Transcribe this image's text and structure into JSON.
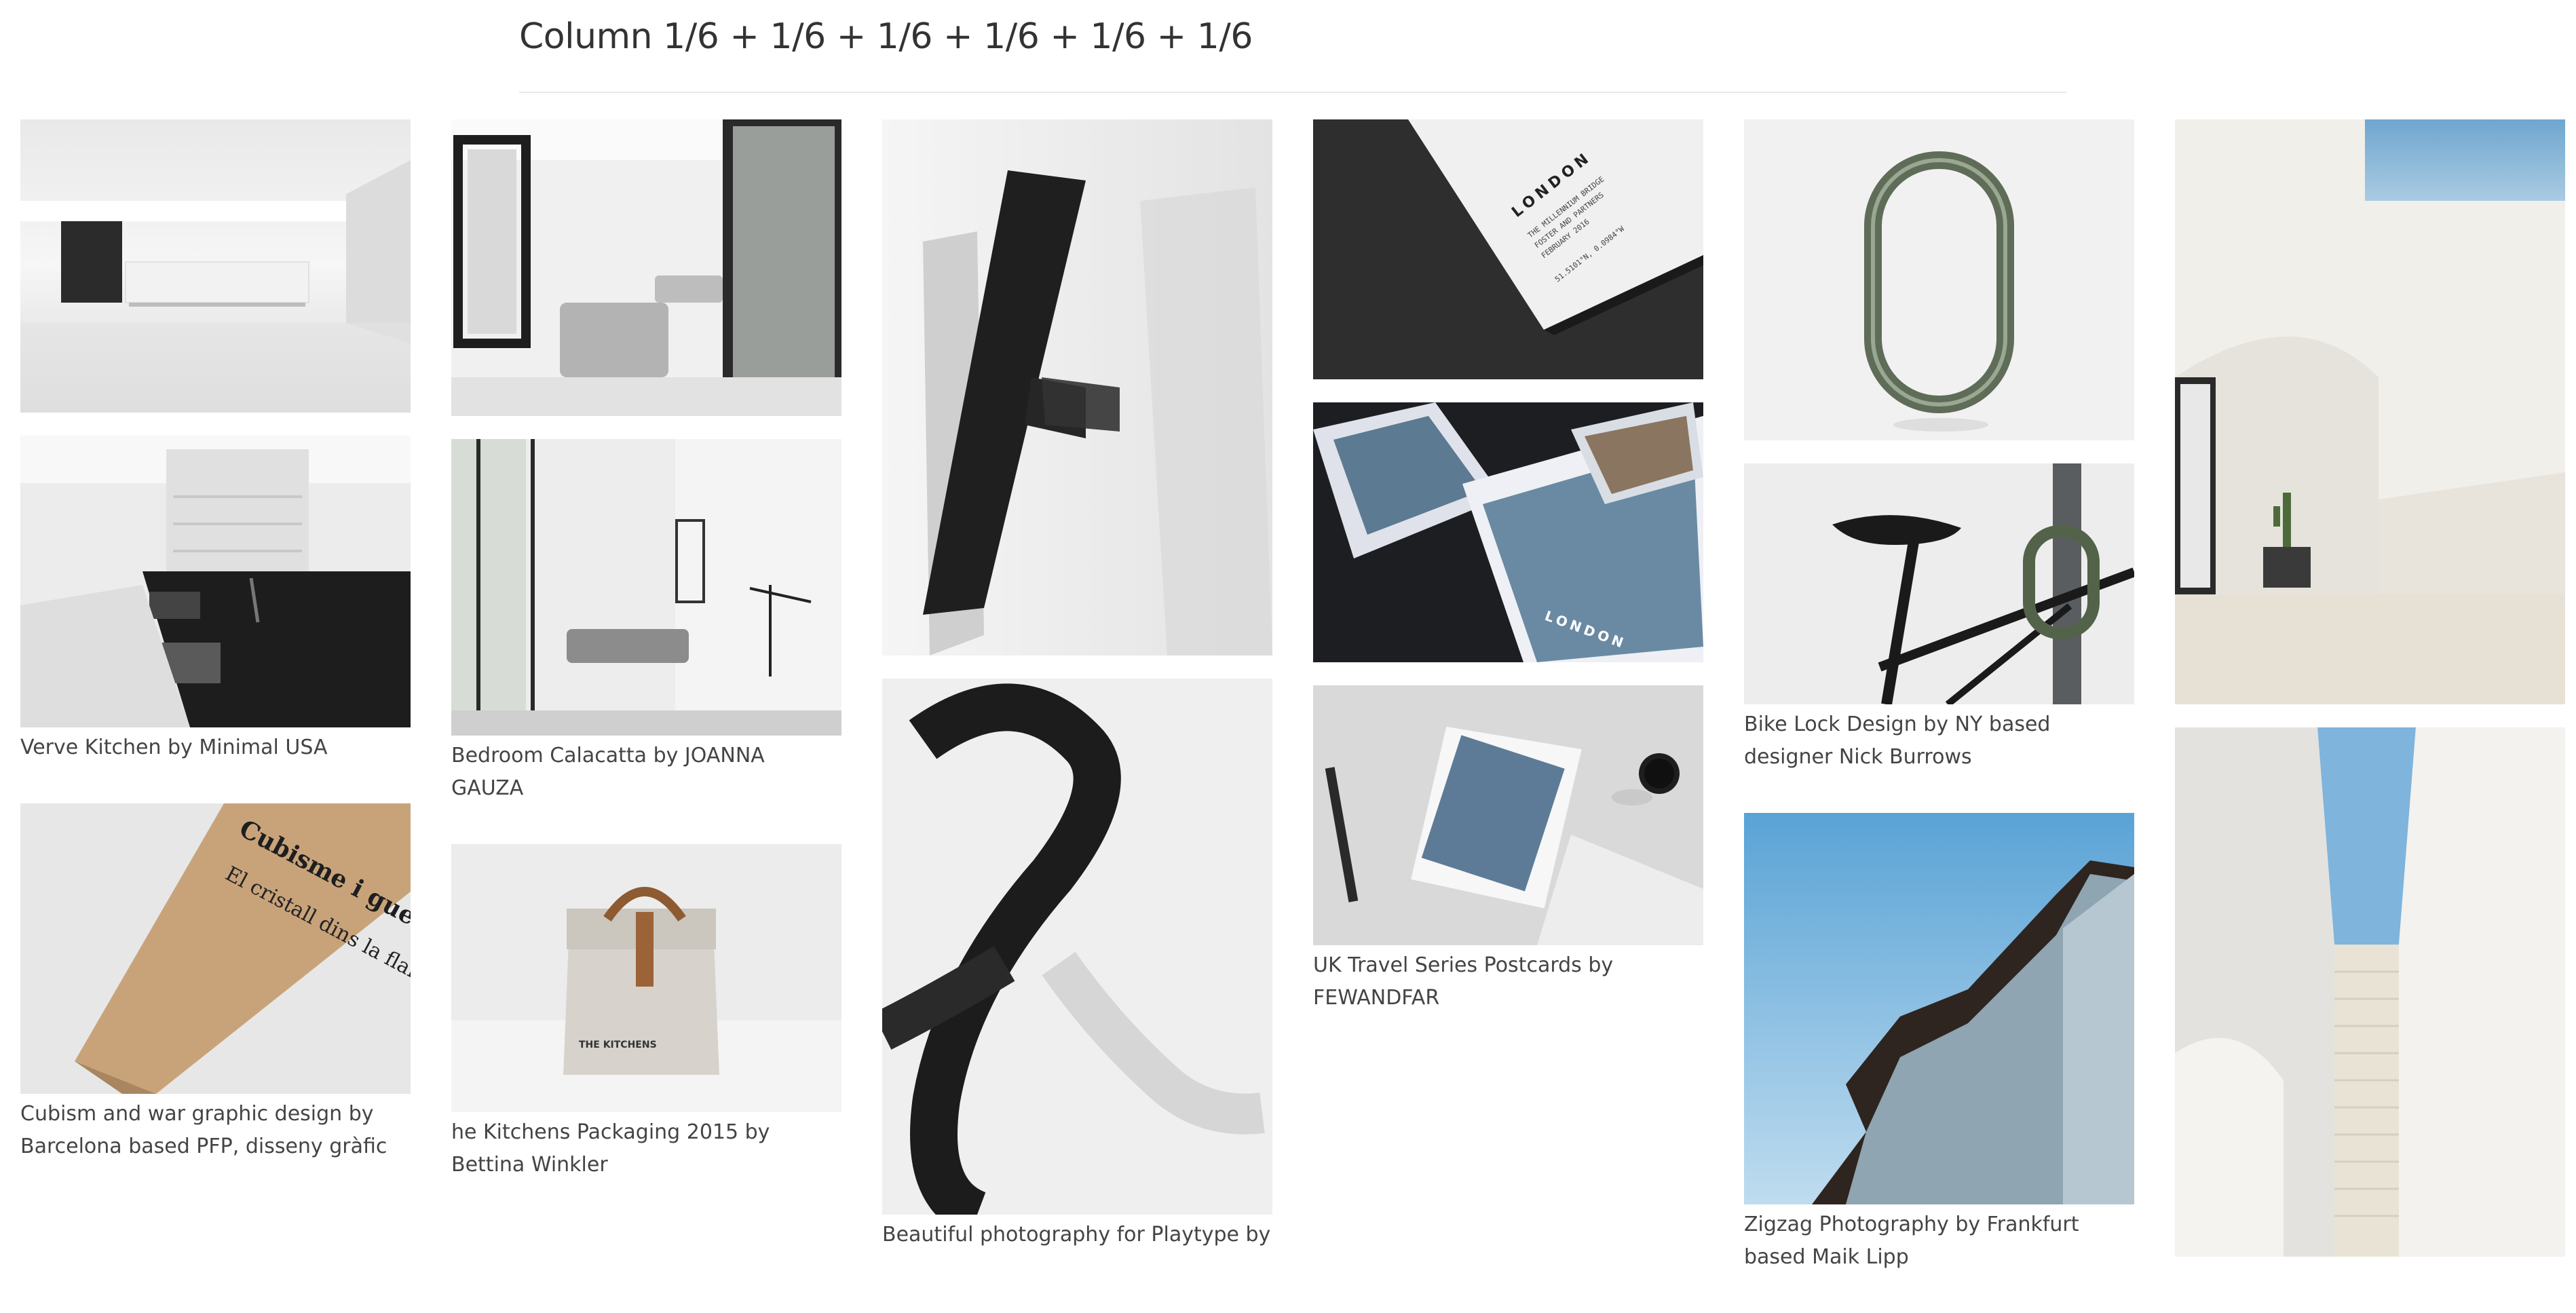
{
  "page": {
    "title": "Column 1/6 + 1/6 + 1/6 + 1/6 + 1/6 + 1/6"
  },
  "columns": [
    {
      "cards": [
        {
          "caption": "",
          "icon": "kitchen-photo"
        },
        {
          "caption": "Verve Kitchen by Minimal USA",
          "icon": "kitchen-island-photo"
        },
        {
          "caption": "Cubism and war graphic design by Barcelona based PFP, disseny gràfic",
          "icon": "poster-photo",
          "print": {
            "title": "Cubisme i guerra",
            "subtitle": "El cristall dins la flama"
          }
        }
      ]
    },
    {
      "cards": [
        {
          "caption": "",
          "icon": "living-room-photo"
        },
        {
          "caption": "Bedroom Calacatta by JOANNA GAUZA",
          "icon": "bedroom-photo"
        },
        {
          "caption": "he Kitchens Packaging 2015 by Bettina Winkler",
          "icon": "bag-photo",
          "print": {
            "label": "THE KITCHENS"
          }
        }
      ]
    },
    {
      "cards": [
        {
          "caption": "",
          "icon": "letter-h-photo"
        },
        {
          "caption": "Beautiful photography for Playtype by",
          "icon": "ampersand-photo"
        }
      ]
    },
    {
      "cards": [
        {
          "caption": "",
          "icon": "london-card-photo",
          "print": {
            "city": "LONDON",
            "line1": "THE MILLENNIUM BRIDGE",
            "line2": "FOSTER AND PARTNERS",
            "line3": "FEBRUARY 2016",
            "coords": "51.5101°N, 0.0984°W"
          }
        },
        {
          "caption": "",
          "icon": "london-prints-photo",
          "print": {
            "city": "LONDON"
          }
        },
        {
          "caption": "UK Travel Series Postcards by FEWANDFAR",
          "icon": "postcard-photo"
        }
      ]
    },
    {
      "cards": [
        {
          "caption": "",
          "icon": "lock-photo"
        },
        {
          "caption": "Bike Lock Design by NY based designer Nick Burrows",
          "icon": "bike-lock-photo"
        },
        {
          "caption": "Zigzag Photography by Frankfurt based Maik Lipp",
          "icon": "building-photo"
        }
      ]
    },
    {
      "cards": [
        {
          "caption": "",
          "icon": "white-house-photo"
        },
        {
          "caption": "",
          "icon": "white-stairs-photo"
        }
      ]
    }
  ]
}
